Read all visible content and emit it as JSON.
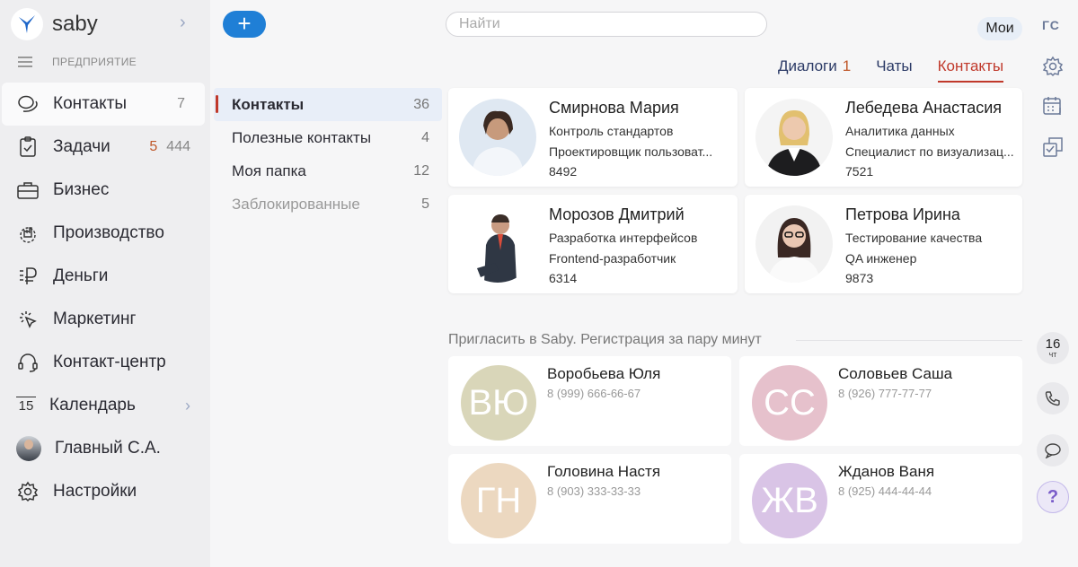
{
  "brand": {
    "name": "saby"
  },
  "org": {
    "label": "ПРЕДПРИЯТИЕ"
  },
  "nav": [
    {
      "label": "Контакты",
      "count": "7"
    },
    {
      "label": "Задачи",
      "count_red": "5",
      "count": "444"
    },
    {
      "label": "Бизнес"
    },
    {
      "label": "Производство"
    },
    {
      "label": "Деньги"
    },
    {
      "label": "Маркетинг"
    },
    {
      "label": "Контакт-центр"
    },
    {
      "label": "Календарь",
      "icon_text": "15"
    },
    {
      "label": "Главный С.А."
    },
    {
      "label": "Настройки"
    }
  ],
  "toolbar": {
    "add_label": "+"
  },
  "search": {
    "placeholder": "Найти"
  },
  "user": {
    "moi_label": "Мои",
    "initials": "ГС"
  },
  "tabs": [
    {
      "label": "Диалоги",
      "badge": "1"
    },
    {
      "label": "Чаты"
    },
    {
      "label": "Контакты"
    }
  ],
  "folders": [
    {
      "label": "Контакты",
      "count": "36"
    },
    {
      "label": "Полезные контакты",
      "count": "4"
    },
    {
      "label": "Моя папка",
      "count": "12"
    },
    {
      "label": "Заблокированные",
      "count": "5"
    }
  ],
  "contacts": [
    {
      "name": "Смирнова Мария",
      "dept": "Контроль стандартов",
      "position": "Проектировщик пользоват...",
      "ext": "8492"
    },
    {
      "name": "Лебедева Анастасия",
      "dept": "Аналитика данных",
      "position": "Специалист по визуализац...",
      "ext": "7521"
    },
    {
      "name": "Морозов Дмитрий",
      "dept": "Разработка интерфейсов",
      "position": "Frontend-разработчик",
      "ext": "6314"
    },
    {
      "name": "Петрова Ирина",
      "dept": "Тестирование качества",
      "position": "QA инженер",
      "ext": "9873"
    }
  ],
  "invite": {
    "title": "Пригласить в Saby. Регистрация за пару минут",
    "people": [
      {
        "initials": "ВЮ",
        "name": "Воробьева Юля",
        "phone": "8 (999) 666-66-67",
        "color": "#d9d6b9"
      },
      {
        "initials": "СС",
        "name": "Соловьев Саша",
        "phone": "8 (926) 777-77-77",
        "color": "#e6c1cc"
      },
      {
        "initials": "ГН",
        "name": "Головина Настя",
        "phone": "8 (903) 333-33-33",
        "color": "#ecd8c0"
      },
      {
        "initials": "ЖВ",
        "name": "Жданов Ваня",
        "phone": "8 (925) 444-44-44",
        "color": "#d9c4e6"
      }
    ]
  },
  "rail": {
    "date_day": "16",
    "date_weekday": "чт",
    "help_label": "?"
  },
  "colors": {
    "accent": "#1f7fd6",
    "active_tab": "#c0392b",
    "badge": "#c0582a"
  }
}
